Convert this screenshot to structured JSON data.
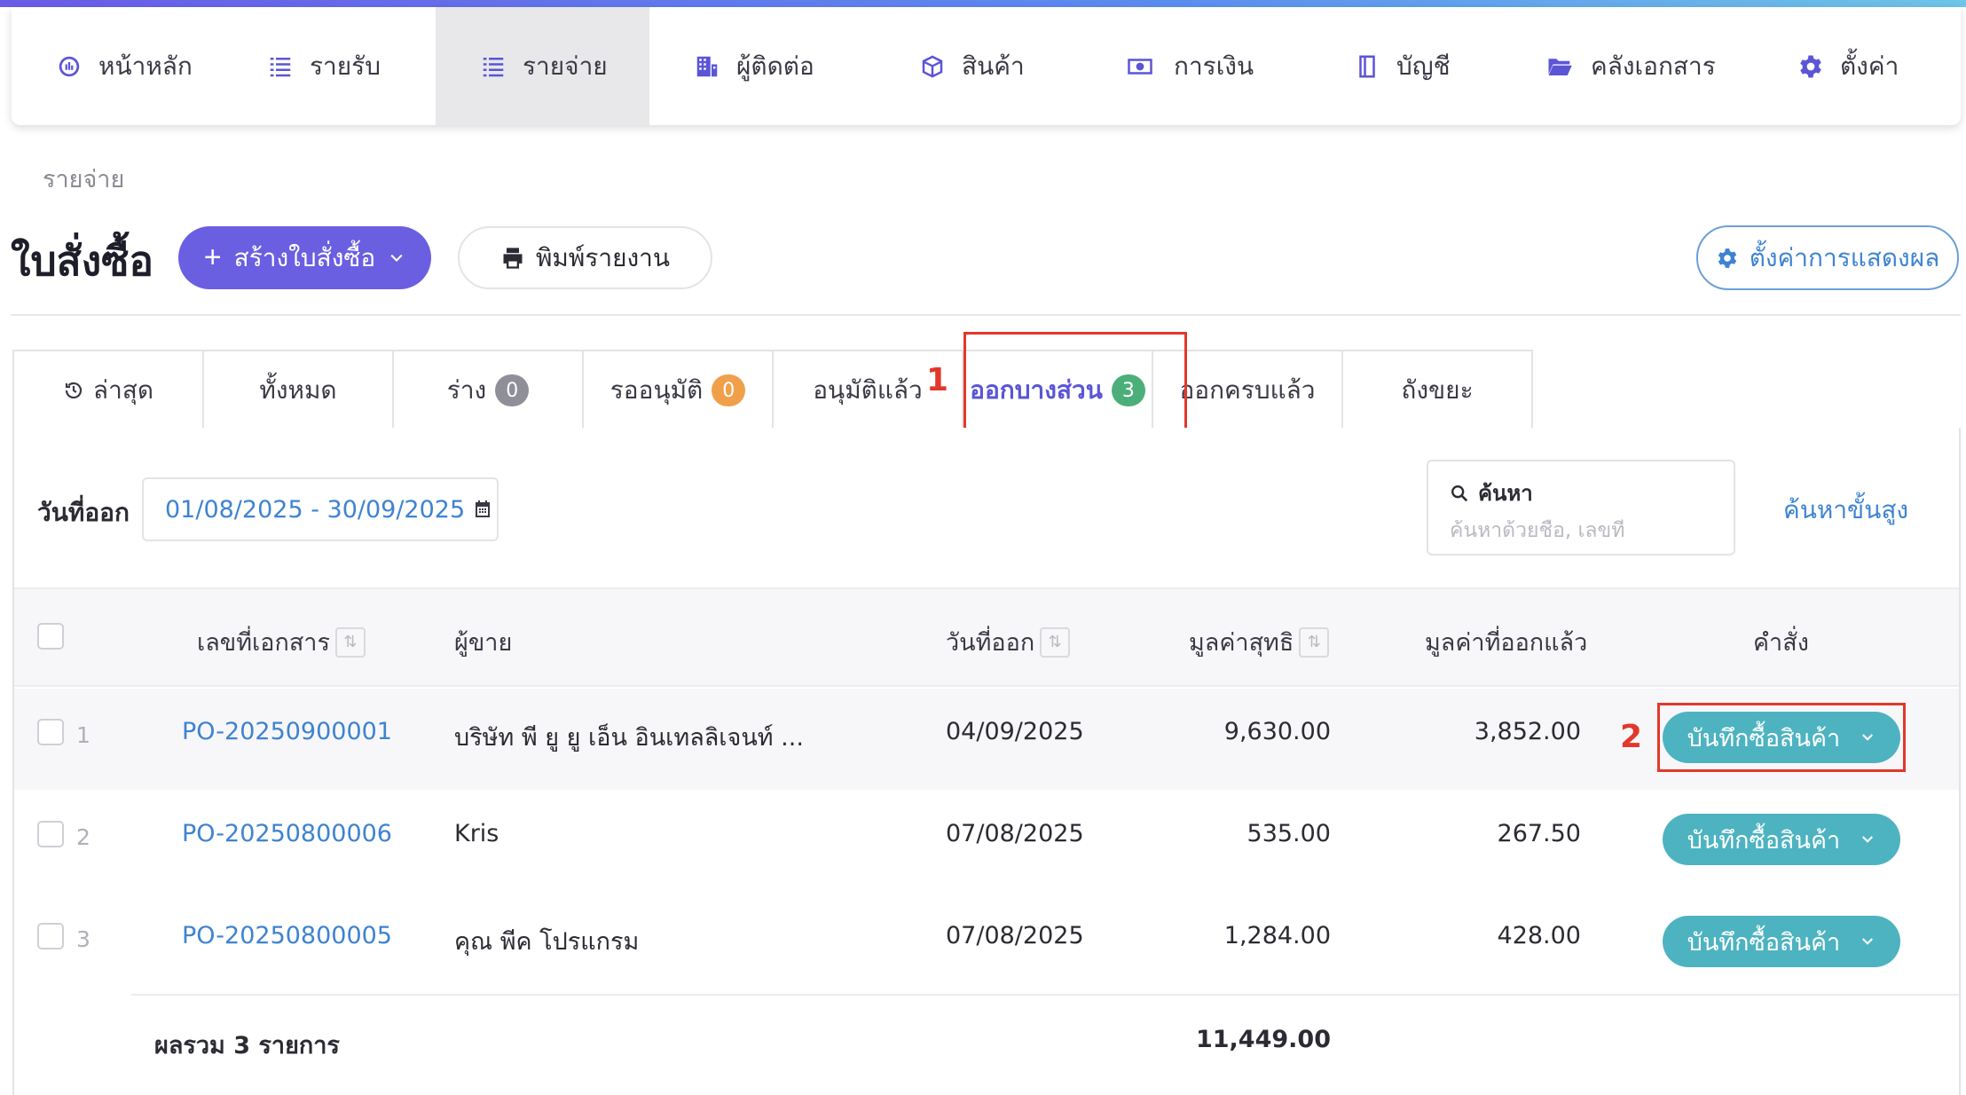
{
  "nav": {
    "items": [
      {
        "label": "หน้าหลัก",
        "icon": "dashboard-icon"
      },
      {
        "label": "รายรับ",
        "icon": "income-list-icon"
      },
      {
        "label": "รายจ่าย",
        "icon": "expense-list-icon",
        "active": true
      },
      {
        "label": "ผู้ติดต่อ",
        "icon": "contacts-building-icon"
      },
      {
        "label": "สินค้า",
        "icon": "product-box-icon"
      },
      {
        "label": "การเงิน",
        "icon": "money-icon"
      },
      {
        "label": "บัญชี",
        "icon": "ledger-book-icon"
      },
      {
        "label": "คลังเอกสาร",
        "icon": "folder-icon"
      },
      {
        "label": "ตั้งค่า",
        "icon": "gear-icon"
      }
    ]
  },
  "breadcrumb": "รายจ่าย",
  "page_title": "ใบสั่งซื้อ",
  "actions": {
    "create_label": "สร้างใบสั่งซื้อ",
    "print_label": "พิมพ์รายงาน",
    "display_settings_label": "ตั้งค่าการแสดงผล"
  },
  "tabs": [
    {
      "label": "ล่าสุด",
      "icon": "history-icon"
    },
    {
      "label": "ทั้งหมด"
    },
    {
      "label": "ร่าง",
      "count": "0",
      "count_color": "#8f8f99"
    },
    {
      "label": "รออนุมัติ",
      "count": "0",
      "count_color": "#f0a04b"
    },
    {
      "label": "อนุมัติแล้ว"
    },
    {
      "label": "ออกบางส่วน",
      "count": "3",
      "count_color": "#4caf7a",
      "selected": true
    },
    {
      "label": "ออกครบแล้ว"
    },
    {
      "label": "ถังขยะ"
    }
  ],
  "callouts": {
    "first": "1",
    "second": "2"
  },
  "filter": {
    "date_label": "วันที่ออก",
    "date_range": "01/08/2025 - 30/09/2025",
    "search_title": "ค้นหา",
    "search_placeholder": "ค้นหาด้วยชื่อ, เลขที่",
    "advanced_search": "ค้นหาขั้นสูง"
  },
  "table": {
    "headers": {
      "doc_no": "เลขที่เอกสาร",
      "vendor": "ผู้ขาย",
      "issue_date": "วันที่ออก",
      "net_value": "มูลค่าสุทธิ",
      "issued_value": "มูลค่าที่ออกแล้ว",
      "command": "คำสั่ง"
    },
    "rows": [
      {
        "index": "1",
        "doc_no": "PO-20250900001",
        "vendor": "บริษัท พี ยู ยู เอ็น อินเทลลิเจนท์ ...",
        "issue_date": "04/09/2025",
        "net_value": "9,630.00",
        "issued_value": "3,852.00",
        "action": "บันทึกซื้อสินค้า"
      },
      {
        "index": "2",
        "doc_no": "PO-20250800006",
        "vendor": "Kris",
        "issue_date": "07/08/2025",
        "net_value": "535.00",
        "issued_value": "267.50",
        "action": "บันทึกซื้อสินค้า"
      },
      {
        "index": "3",
        "doc_no": "PO-20250800005",
        "vendor": "คุณ พีค โปรแกรม",
        "issue_date": "07/08/2025",
        "net_value": "1,284.00",
        "issued_value": "428.00",
        "action": "บันทึกซื้อสินค้า"
      }
    ],
    "footer": {
      "label": "ผลรวม 3 รายการ",
      "total_net": "11,449.00"
    }
  }
}
